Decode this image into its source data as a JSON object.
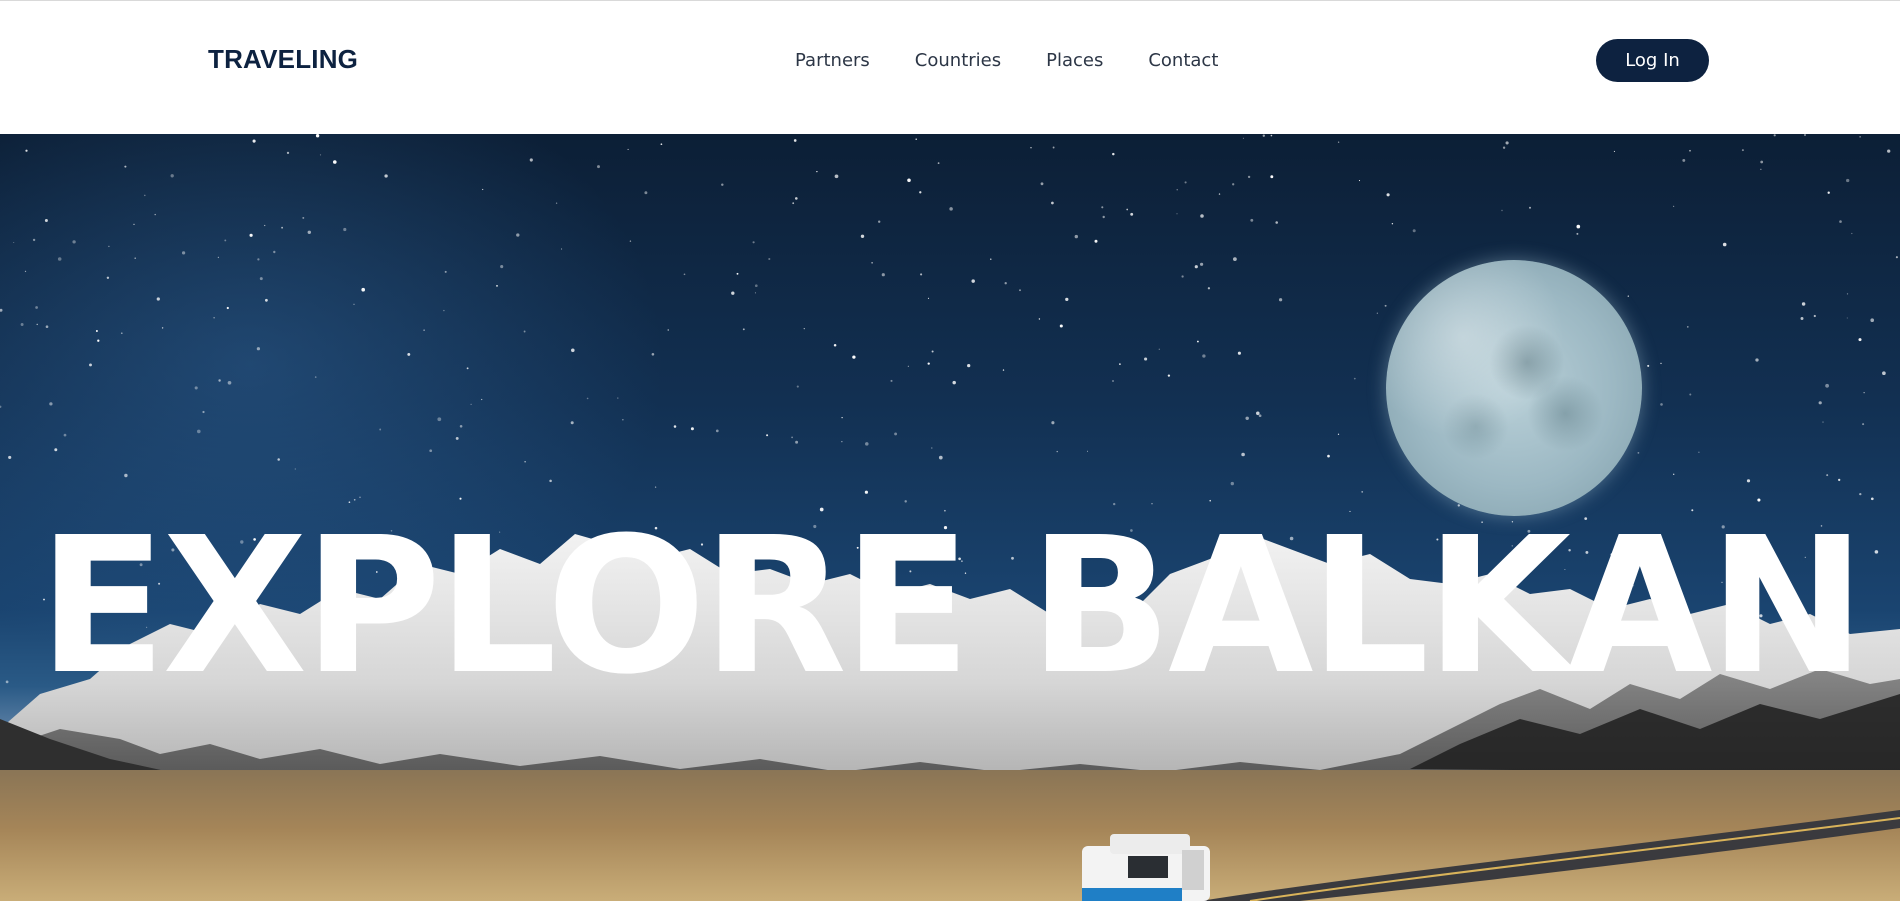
{
  "header": {
    "logo": "TRAVELING",
    "nav": [
      "Partners",
      "Countries",
      "Places",
      "Contact"
    ],
    "login_label": "Log In"
  },
  "hero": {
    "headline": "EXPLORE BALKAN"
  },
  "colors": {
    "brand": "#0d2240",
    "nav_text": "#2c3646",
    "headline": "#ffffff"
  },
  "icons": [
    "moon-image",
    "mountains-image",
    "camper-van-image",
    "road-image"
  ]
}
